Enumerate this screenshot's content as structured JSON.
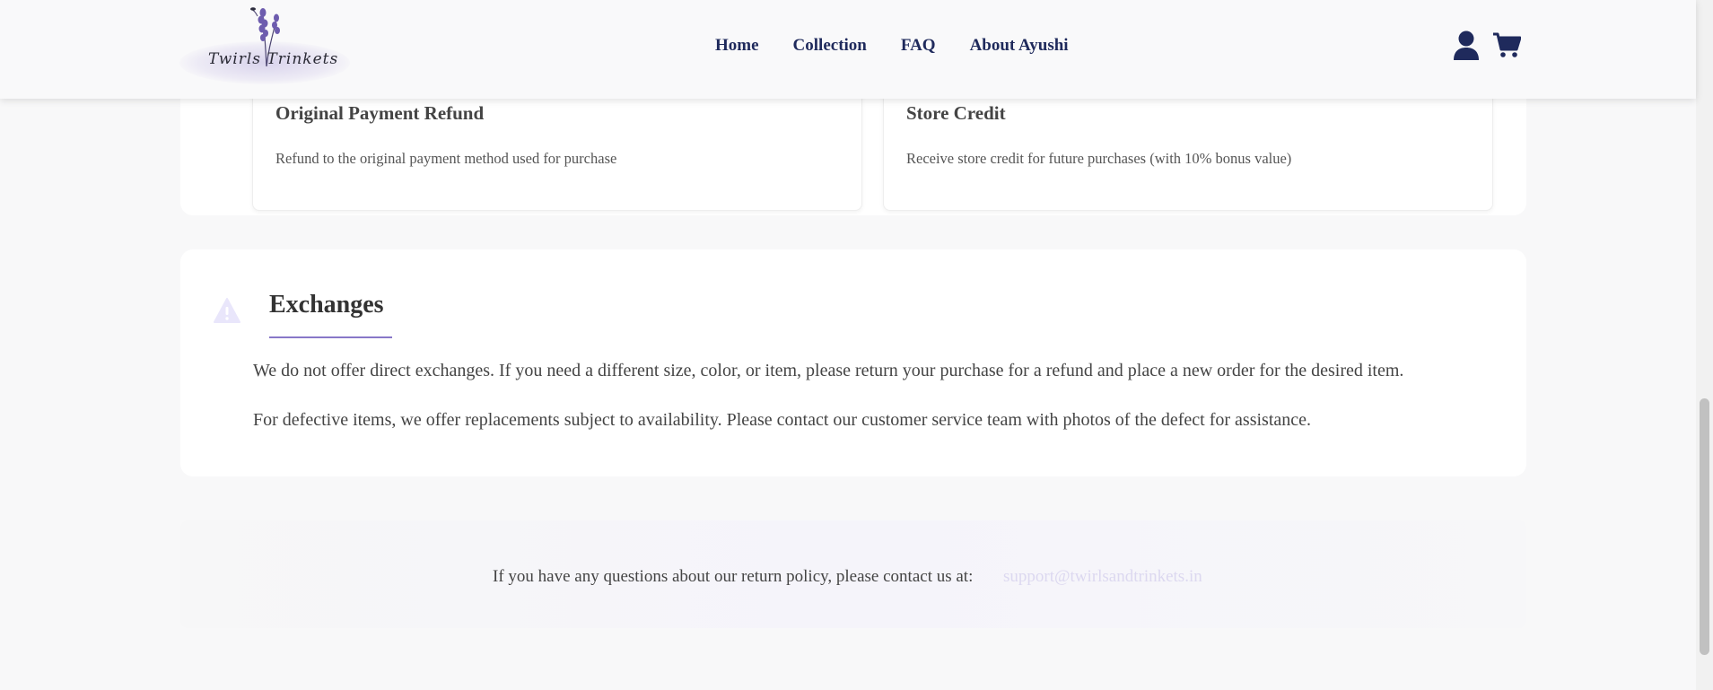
{
  "header": {
    "logo_text": "Twirls  Trinkets",
    "nav": [
      "Home",
      "Collection",
      "FAQ",
      "About Ayushi"
    ],
    "icons": [
      "user-icon",
      "cart-icon"
    ]
  },
  "refund_options": [
    {
      "title": "Original Payment Refund",
      "desc": "Refund to the original payment method used for purchase"
    },
    {
      "title": "Store Credit",
      "desc": "Receive store credit for future purchases (with 10% bonus value)"
    }
  ],
  "exchanges": {
    "title": "Exchanges",
    "icon": "warning-icon",
    "paragraphs": [
      "We do not offer direct exchanges. If you need a different size, color, or item, please return your purchase for a refund and place a new order for the desired item.",
      "For defective items, we offer replacements subject to availability. Please contact our customer service team with photos of the defect for assistance."
    ]
  },
  "contact": {
    "prefix": "If you have any questions about our return policy, please contact us at:",
    "email": "support@twirlsandtrinkets.in"
  },
  "colors": {
    "nav": "#1f2a5c",
    "accent": "#8878c8",
    "email": "#dcd8f0"
  }
}
